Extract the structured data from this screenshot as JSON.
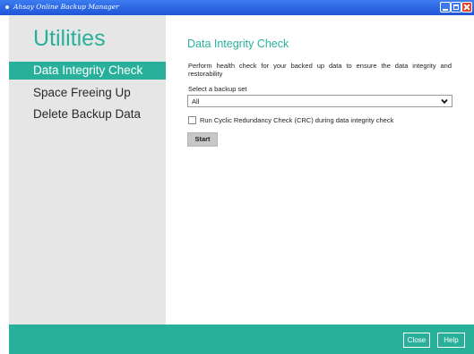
{
  "window": {
    "title": "Ahsay Online Backup Manager",
    "controls": {
      "minimize": "minimize",
      "maximize": "maximize",
      "close": "close"
    }
  },
  "sidebar": {
    "title": "Utilities",
    "items": [
      {
        "label": "Data Integrity Check",
        "active": true
      },
      {
        "label": "Space Freeing Up",
        "active": false
      },
      {
        "label": "Delete Backup Data",
        "active": false
      }
    ]
  },
  "main": {
    "title": "Data Integrity Check",
    "description": "Perform health check for your backed up data to ensure the data integrity and restorability",
    "select_label": "Select a backup set",
    "select_value": "All",
    "crc_label": "Run Cyclic Redundancy Check (CRC) during data integrity check",
    "crc_checked": false,
    "start_label": "Start"
  },
  "footer": {
    "close_label": "Close",
    "help_label": "Help"
  },
  "colors": {
    "accent": "#29b09b",
    "titlebar": "#2a62e0",
    "sidebar_bg": "#e6e6e6"
  }
}
